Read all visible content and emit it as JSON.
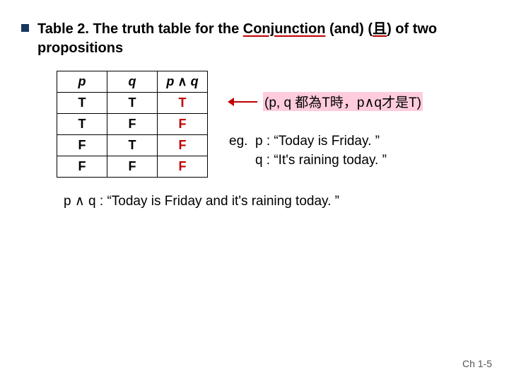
{
  "title": {
    "lead": "Table 2. The truth table for the ",
    "underlined": "Conjunction",
    "mid": " (and) (",
    "underlined2": "且",
    "tail": ") of two propositions"
  },
  "table": {
    "headers": {
      "c1": "p",
      "c2": "q",
      "c3_pre": "p ",
      "c3_sym": "∧",
      "c3_post": " q"
    },
    "rows": [
      {
        "p": "T",
        "q": "T",
        "r": "T",
        "rclass": "first-t"
      },
      {
        "p": "T",
        "q": "F",
        "r": "F",
        "rclass": "f-red"
      },
      {
        "p": "F",
        "q": "T",
        "r": "F",
        "rclass": "f-red"
      },
      {
        "p": "F",
        "q": "F",
        "r": "F",
        "rclass": "f-red"
      }
    ]
  },
  "note": {
    "pre": "(p, q 都為T時，p",
    "sym": "∧",
    "post": "q才是T)"
  },
  "eg": {
    "label": "eg.",
    "p": "p : “Today is Friday. ”",
    "q": "q : “It's raining today. ”"
  },
  "sentence": {
    "p": "p ",
    "sym": "∧",
    "rest": " q : “Today is Friday and it's raining today. ”"
  },
  "footer": "Ch 1-5"
}
